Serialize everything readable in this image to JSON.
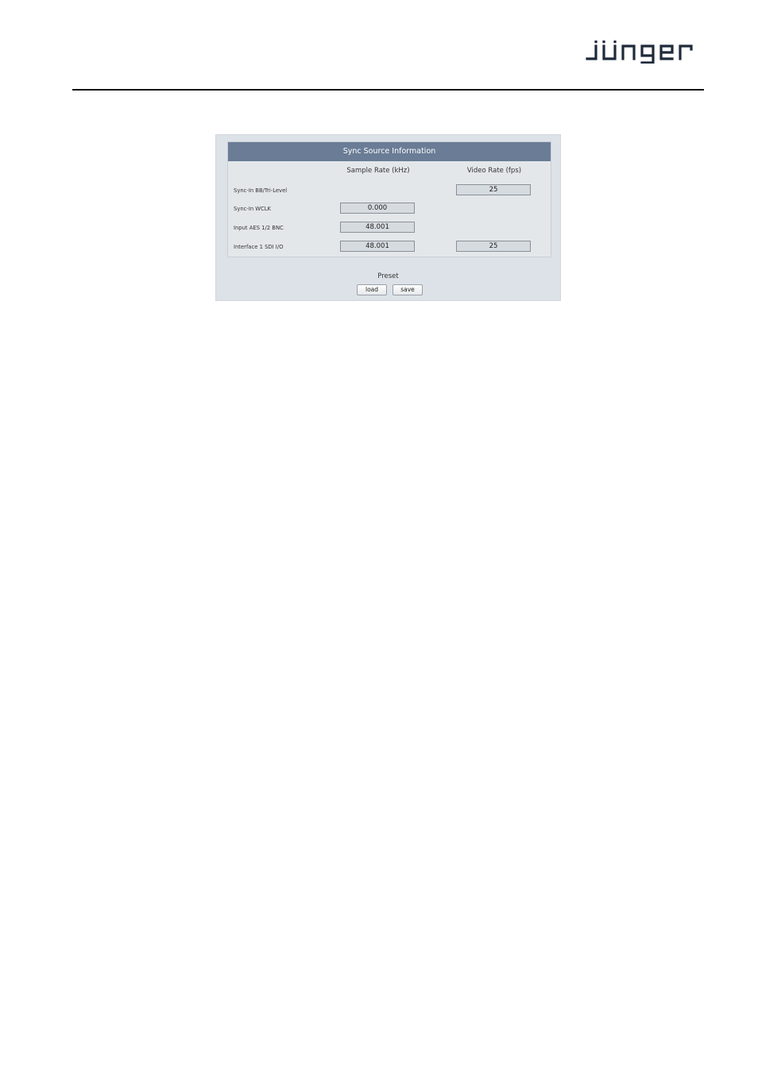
{
  "logo": {
    "alt": "jünger",
    "color": "#1e2a3a"
  },
  "panel": {
    "title": "Sync Source Information",
    "header_color": "#6a7c96",
    "columns": {
      "sample_rate": "Sample Rate (kHz)",
      "video_rate": "Video Rate (fps)"
    },
    "rows": [
      {
        "label": "Sync-In BB/Tri-Level",
        "sample_rate": null,
        "video_rate": "25"
      },
      {
        "label": "Sync-In WCLK",
        "sample_rate": "0.000",
        "video_rate": null
      },
      {
        "label": "Input AES 1/2 BNC",
        "sample_rate": "48.001",
        "video_rate": null
      },
      {
        "label": "Interface 1 SDI I/O",
        "sample_rate": "48.001",
        "video_rate": "25"
      }
    ]
  },
  "preset": {
    "label": "Preset",
    "load_label": "load",
    "save_label": "save"
  }
}
